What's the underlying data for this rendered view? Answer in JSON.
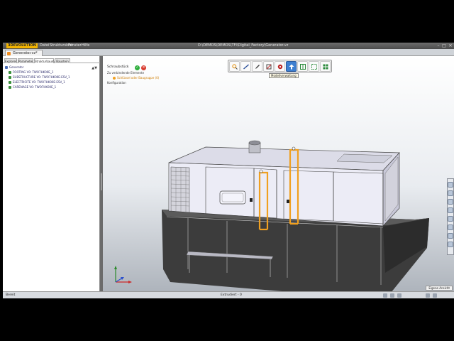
{
  "app": {
    "logo_text": "3DEVOLUTION",
    "menus": [
      "Datei",
      "Struktursicht",
      "Fenster",
      "Hilfe"
    ],
    "window_title": "D:\\DEMOS\\DEMOS\\TFI\\Digital_Factory\\Generator.vz",
    "win_buttons": [
      "–",
      "□",
      "✕"
    ]
  },
  "document": {
    "tab_label": "Generator.vz*"
  },
  "left_panel": {
    "tabs": [
      "Explorer",
      "Parameter",
      "Strukturbaum",
      "Baustein"
    ],
    "active_tab": 2,
    "collapse_icon": "▲▼",
    "tree": [
      {
        "label": "Generator",
        "level": 0
      },
      {
        "label": "FOOTING V0: TWO7HK00E_1",
        "level": 1
      },
      {
        "label": "SUBSTRUCTURE V0: TWO7HK00E-ESV_1",
        "level": 1
      },
      {
        "label": "ELECTRICITE V0: TWO7HK00E-ESV_1",
        "level": 1
      },
      {
        "label": "CARENAGE V0: TWO7HK00E_1",
        "level": 1
      }
    ]
  },
  "viewport": {
    "toolbar": [
      {
        "icon": "zoom-icon",
        "active": false
      },
      {
        "icon": "measure-icon",
        "active": false
      },
      {
        "icon": "edit-icon",
        "active": false
      },
      {
        "icon": "section-icon",
        "active": false
      },
      {
        "icon": "disk-icon",
        "active": false
      },
      {
        "icon": "arrow-up-icon",
        "active": true
      },
      {
        "icon": "split-icon",
        "active": false
      },
      {
        "icon": "fit-icon",
        "active": false
      },
      {
        "icon": "grid-icon",
        "active": false
      }
    ],
    "tooltip": "Modellverwaltung",
    "property_box": {
      "title": "Schraubstück",
      "ok_symbol": "✓",
      "cancel_symbol": "✕",
      "lines": [
        "Zu verbindende Elemente",
        "Schlüssel oder Baugruppe (0)",
        "Konfiguration"
      ]
    },
    "named_view": "Eigene Ansicht",
    "colors": {
      "model_fill": "#ececf6",
      "base_fill": "#3a3a3a",
      "highlight": "#f0a020"
    }
  },
  "status": {
    "left": "Bereit",
    "center": "Extrudiert - 0"
  }
}
